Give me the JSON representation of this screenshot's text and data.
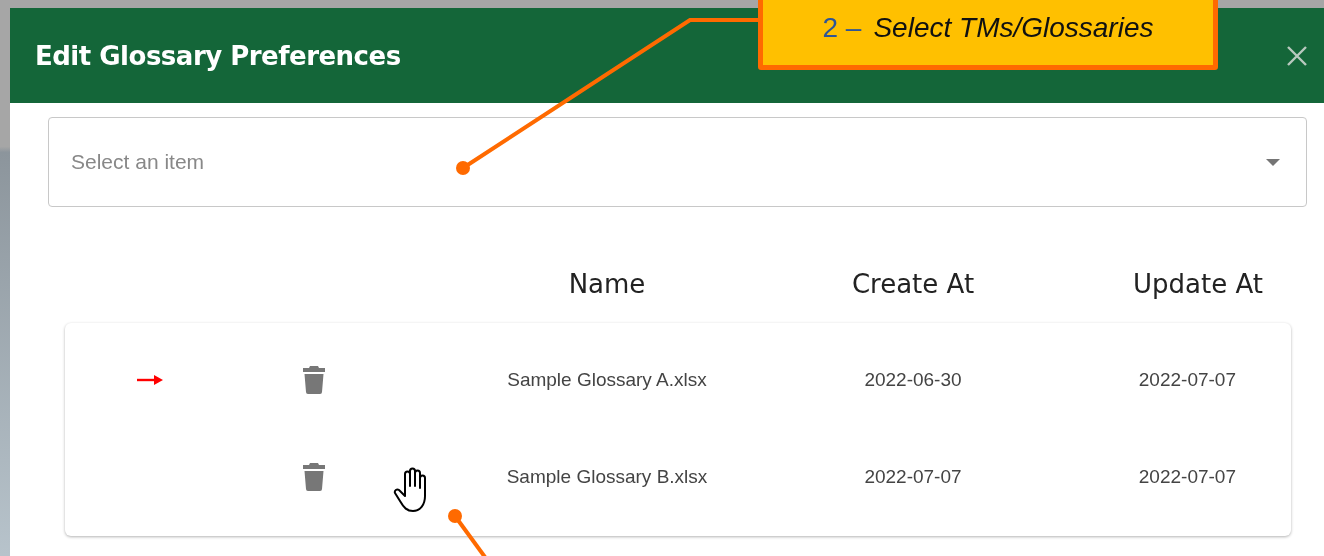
{
  "dialog": {
    "title": "Edit Glossary Preferences"
  },
  "callout": {
    "number": "2 –",
    "text": "Select TMs/Glossaries"
  },
  "select": {
    "placeholder": "Select an item"
  },
  "table": {
    "columns": [
      "Name",
      "Create At",
      "Update At"
    ],
    "rows": [
      {
        "marked": true,
        "name": "Sample Glossary A.xlsx",
        "created": "2022-06-30",
        "updated": "2022-07-07"
      },
      {
        "marked": false,
        "name": "Sample Glossary B.xlsx",
        "created": "2022-07-07",
        "updated": "2022-07-07"
      }
    ]
  }
}
